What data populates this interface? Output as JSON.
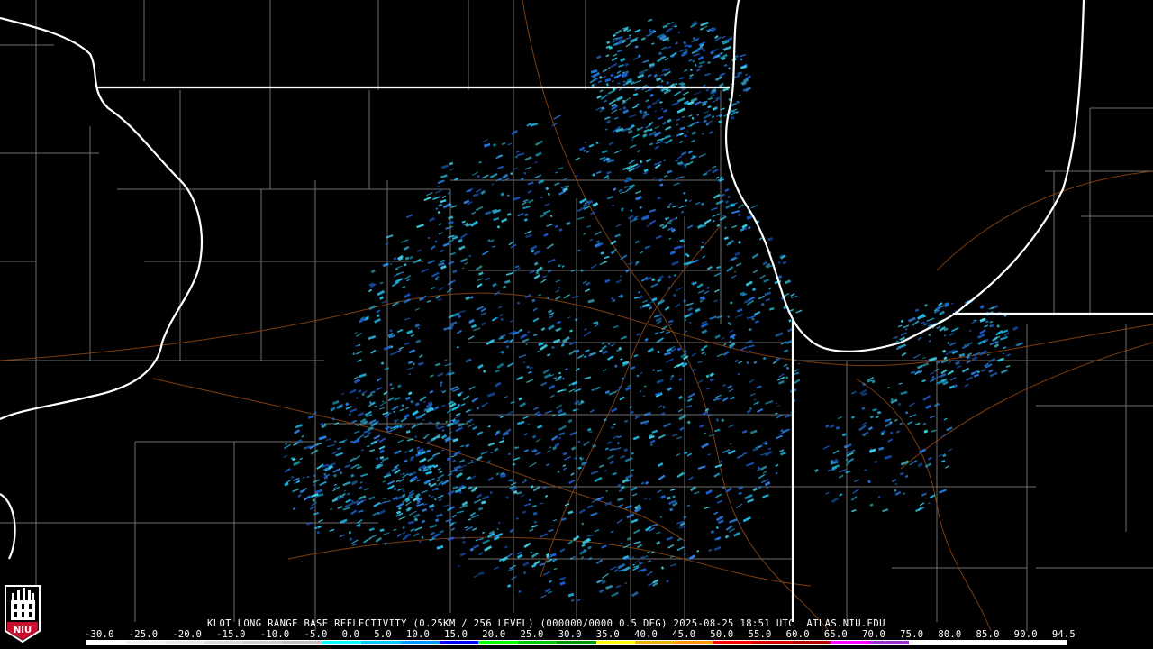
{
  "product": {
    "caption": "KLOT LONG RANGE BASE REFLECTIVITY (0.25KM / 256 LEVEL) (000000/0000 0.5 DEG) 2025-08-25 18:51 UTC  ATLAS.NIU.EDU"
  },
  "scale": {
    "ticks": [
      "-30.0",
      "-25.0",
      "-20.0",
      "-15.0",
      "-10.0",
      "-5.0",
      "0.0",
      "5.0",
      "10.0",
      "15.0",
      "20.0",
      "25.0",
      "30.0",
      "35.0",
      "40.0",
      "45.0",
      "50.0",
      "55.0",
      "60.0",
      "65.0",
      "70.0",
      "75.0",
      "80.0",
      "85.0",
      "90.0",
      "94.5"
    ],
    "colors": [
      "#ffffff",
      "#f2f2f2",
      "#e6e6e6",
      "#d9d9d9",
      "#cccccc",
      "#bfbfbf",
      "#00ffff",
      "#00c8ff",
      "#0096ff",
      "#0000ff",
      "#00ff00",
      "#00c800",
      "#009600",
      "#ffff00",
      "#e6b400",
      "#ff9600",
      "#ff0000",
      "#d20000",
      "#b40000",
      "#ff00ff",
      "#9932cc",
      "#ffffff",
      "#ffffff",
      "#ffffff",
      "#ffffff"
    ]
  },
  "logo": {
    "text": "NIU",
    "icon": "niu-logo-icon"
  },
  "map": {
    "radar_site": "KLOT",
    "boundary_color": "#ffffff",
    "county_color": "#7a7a7a",
    "highway_color": "#8b4513",
    "echo_colors": [
      "#1fb8e6",
      "#2a7fe0",
      "#1a5fd0",
      "#3fd0e8"
    ]
  }
}
